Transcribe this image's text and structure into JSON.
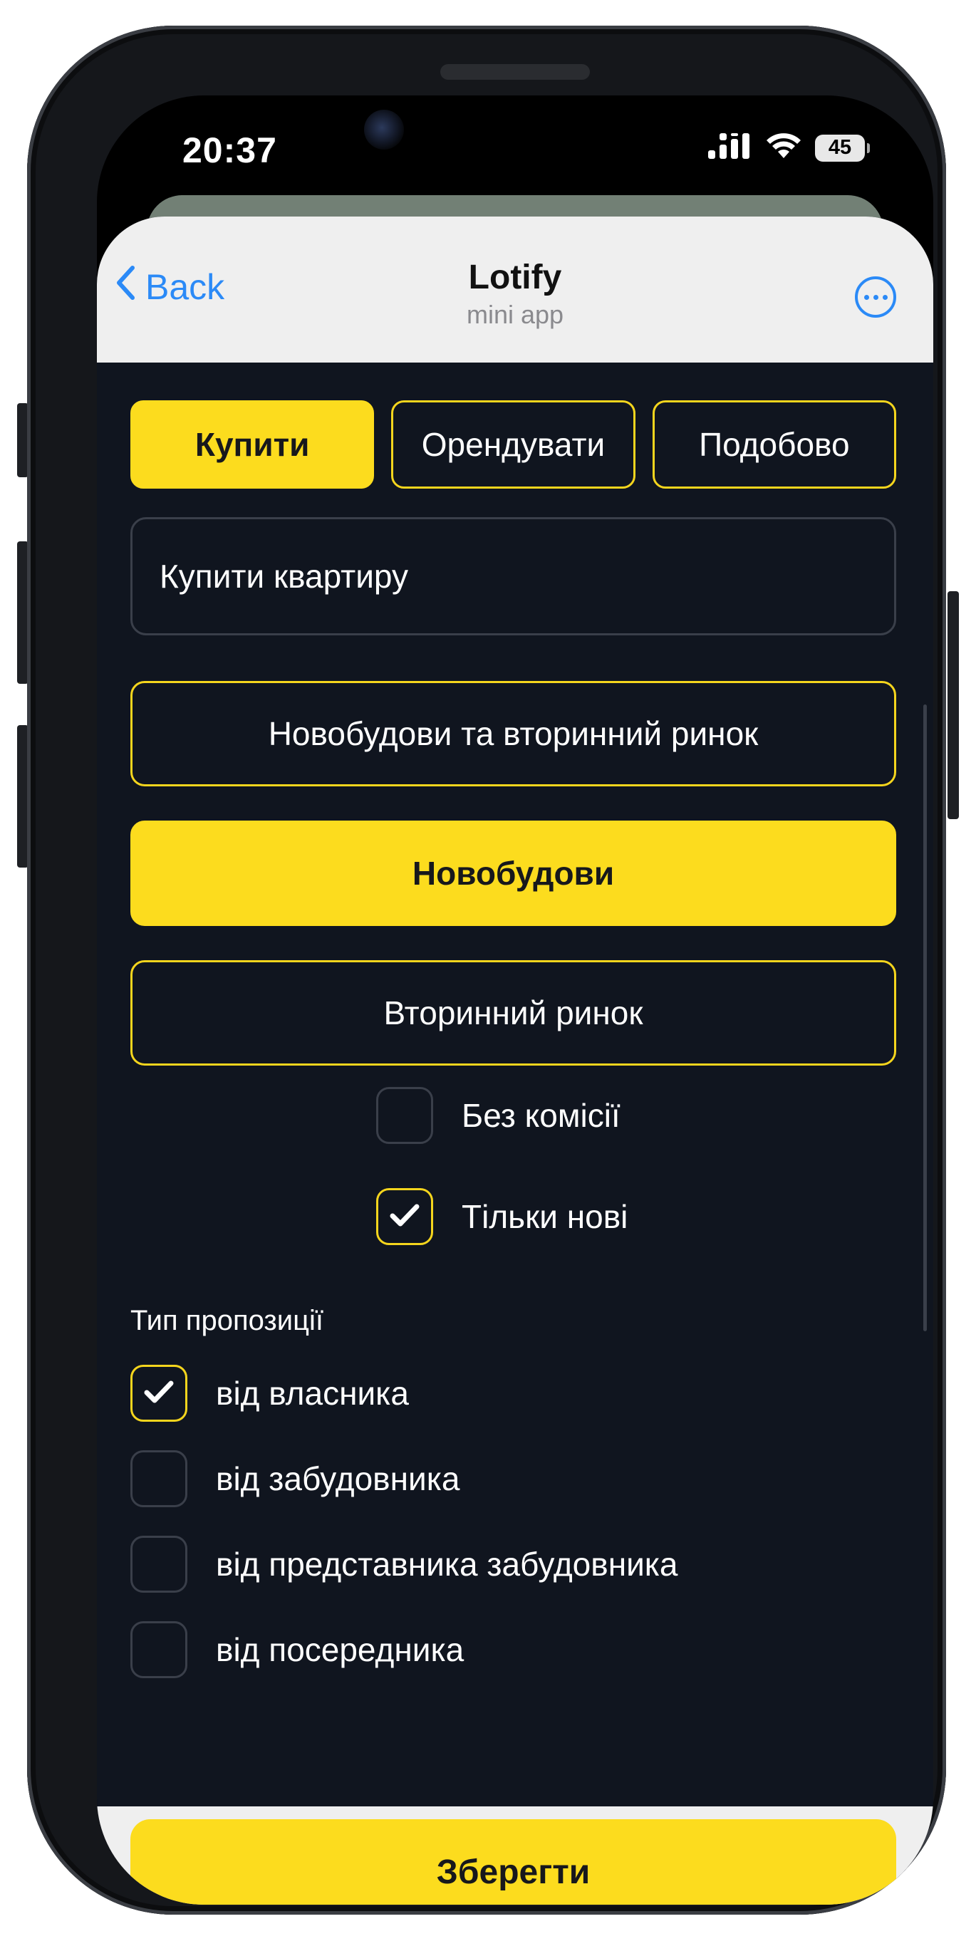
{
  "status_bar": {
    "time": "20:37",
    "battery": "45"
  },
  "header": {
    "back_label": "Back",
    "title": "Lotify",
    "subtitle": "mini app"
  },
  "tabs": [
    {
      "label": "Купити",
      "active": true
    },
    {
      "label": "Орендувати",
      "active": false
    },
    {
      "label": "Подобово",
      "active": false
    }
  ],
  "property_select": {
    "value": "Купити квартиру"
  },
  "market_options": [
    {
      "label": "Новобудови та вторинний ринок",
      "active": false
    },
    {
      "label": "Новобудови",
      "active": true
    },
    {
      "label": "Вторинний ринок",
      "active": false
    }
  ],
  "toggles": [
    {
      "label": "Без комісії",
      "checked": false
    },
    {
      "label": "Тільки нові",
      "checked": true
    }
  ],
  "offer_type": {
    "title": "Тип пропозиції",
    "items": [
      {
        "label": "від власника",
        "checked": true
      },
      {
        "label": "від забудовника",
        "checked": false
      },
      {
        "label": "від представника забудовника",
        "checked": false
      },
      {
        "label": "від посередника",
        "checked": false
      }
    ]
  },
  "save_label": "Зберегти",
  "colors": {
    "accent": "#fcdc1e",
    "background": "#10151f",
    "link": "#2b8af7"
  }
}
